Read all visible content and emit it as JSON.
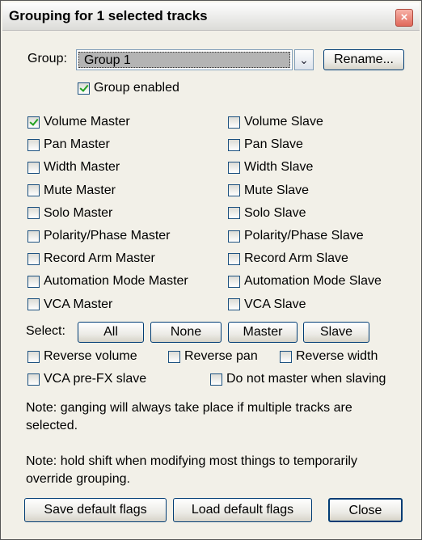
{
  "window": {
    "title": "Grouping for 1 selected tracks",
    "close_symbol": "×"
  },
  "group": {
    "label": "Group:",
    "selected": "Group 1",
    "dropdown_symbol": "⌄",
    "rename_label": "Rename...",
    "enabled_label": "Group enabled",
    "enabled": true
  },
  "masters": [
    {
      "label": "Volume Master",
      "checked": true
    },
    {
      "label": "Pan Master",
      "checked": false
    },
    {
      "label": "Width Master",
      "checked": false
    },
    {
      "label": "Mute Master",
      "checked": false
    },
    {
      "label": "Solo Master",
      "checked": false
    },
    {
      "label": "Polarity/Phase Master",
      "checked": false
    },
    {
      "label": "Record Arm Master",
      "checked": false
    },
    {
      "label": "Automation Mode Master",
      "checked": false
    },
    {
      "label": "VCA Master",
      "checked": false
    }
  ],
  "slaves": [
    {
      "label": "Volume Slave",
      "checked": false
    },
    {
      "label": "Pan Slave",
      "checked": false
    },
    {
      "label": "Width Slave",
      "checked": false
    },
    {
      "label": "Mute Slave",
      "checked": false
    },
    {
      "label": "Solo Slave",
      "checked": false
    },
    {
      "label": "Polarity/Phase Slave",
      "checked": false
    },
    {
      "label": "Record Arm Slave",
      "checked": false
    },
    {
      "label": "Automation Mode Slave",
      "checked": false
    },
    {
      "label": "VCA Slave",
      "checked": false
    }
  ],
  "select": {
    "label": "Select:",
    "all": "All",
    "none": "None",
    "master": "Master",
    "slave": "Slave"
  },
  "options": {
    "reverse_volume": "Reverse volume",
    "reverse_pan": "Reverse pan",
    "reverse_width": "Reverse width",
    "vca_prefx": "VCA pre-FX slave",
    "no_master": "Do not master when slaving"
  },
  "notes": {
    "note1": "Note: ganging will always take place if multiple tracks are selected.",
    "note2": "Note: hold shift when modifying most things to temporarily override grouping."
  },
  "footer": {
    "save": "Save default flags",
    "load": "Load default flags",
    "close": "Close"
  }
}
